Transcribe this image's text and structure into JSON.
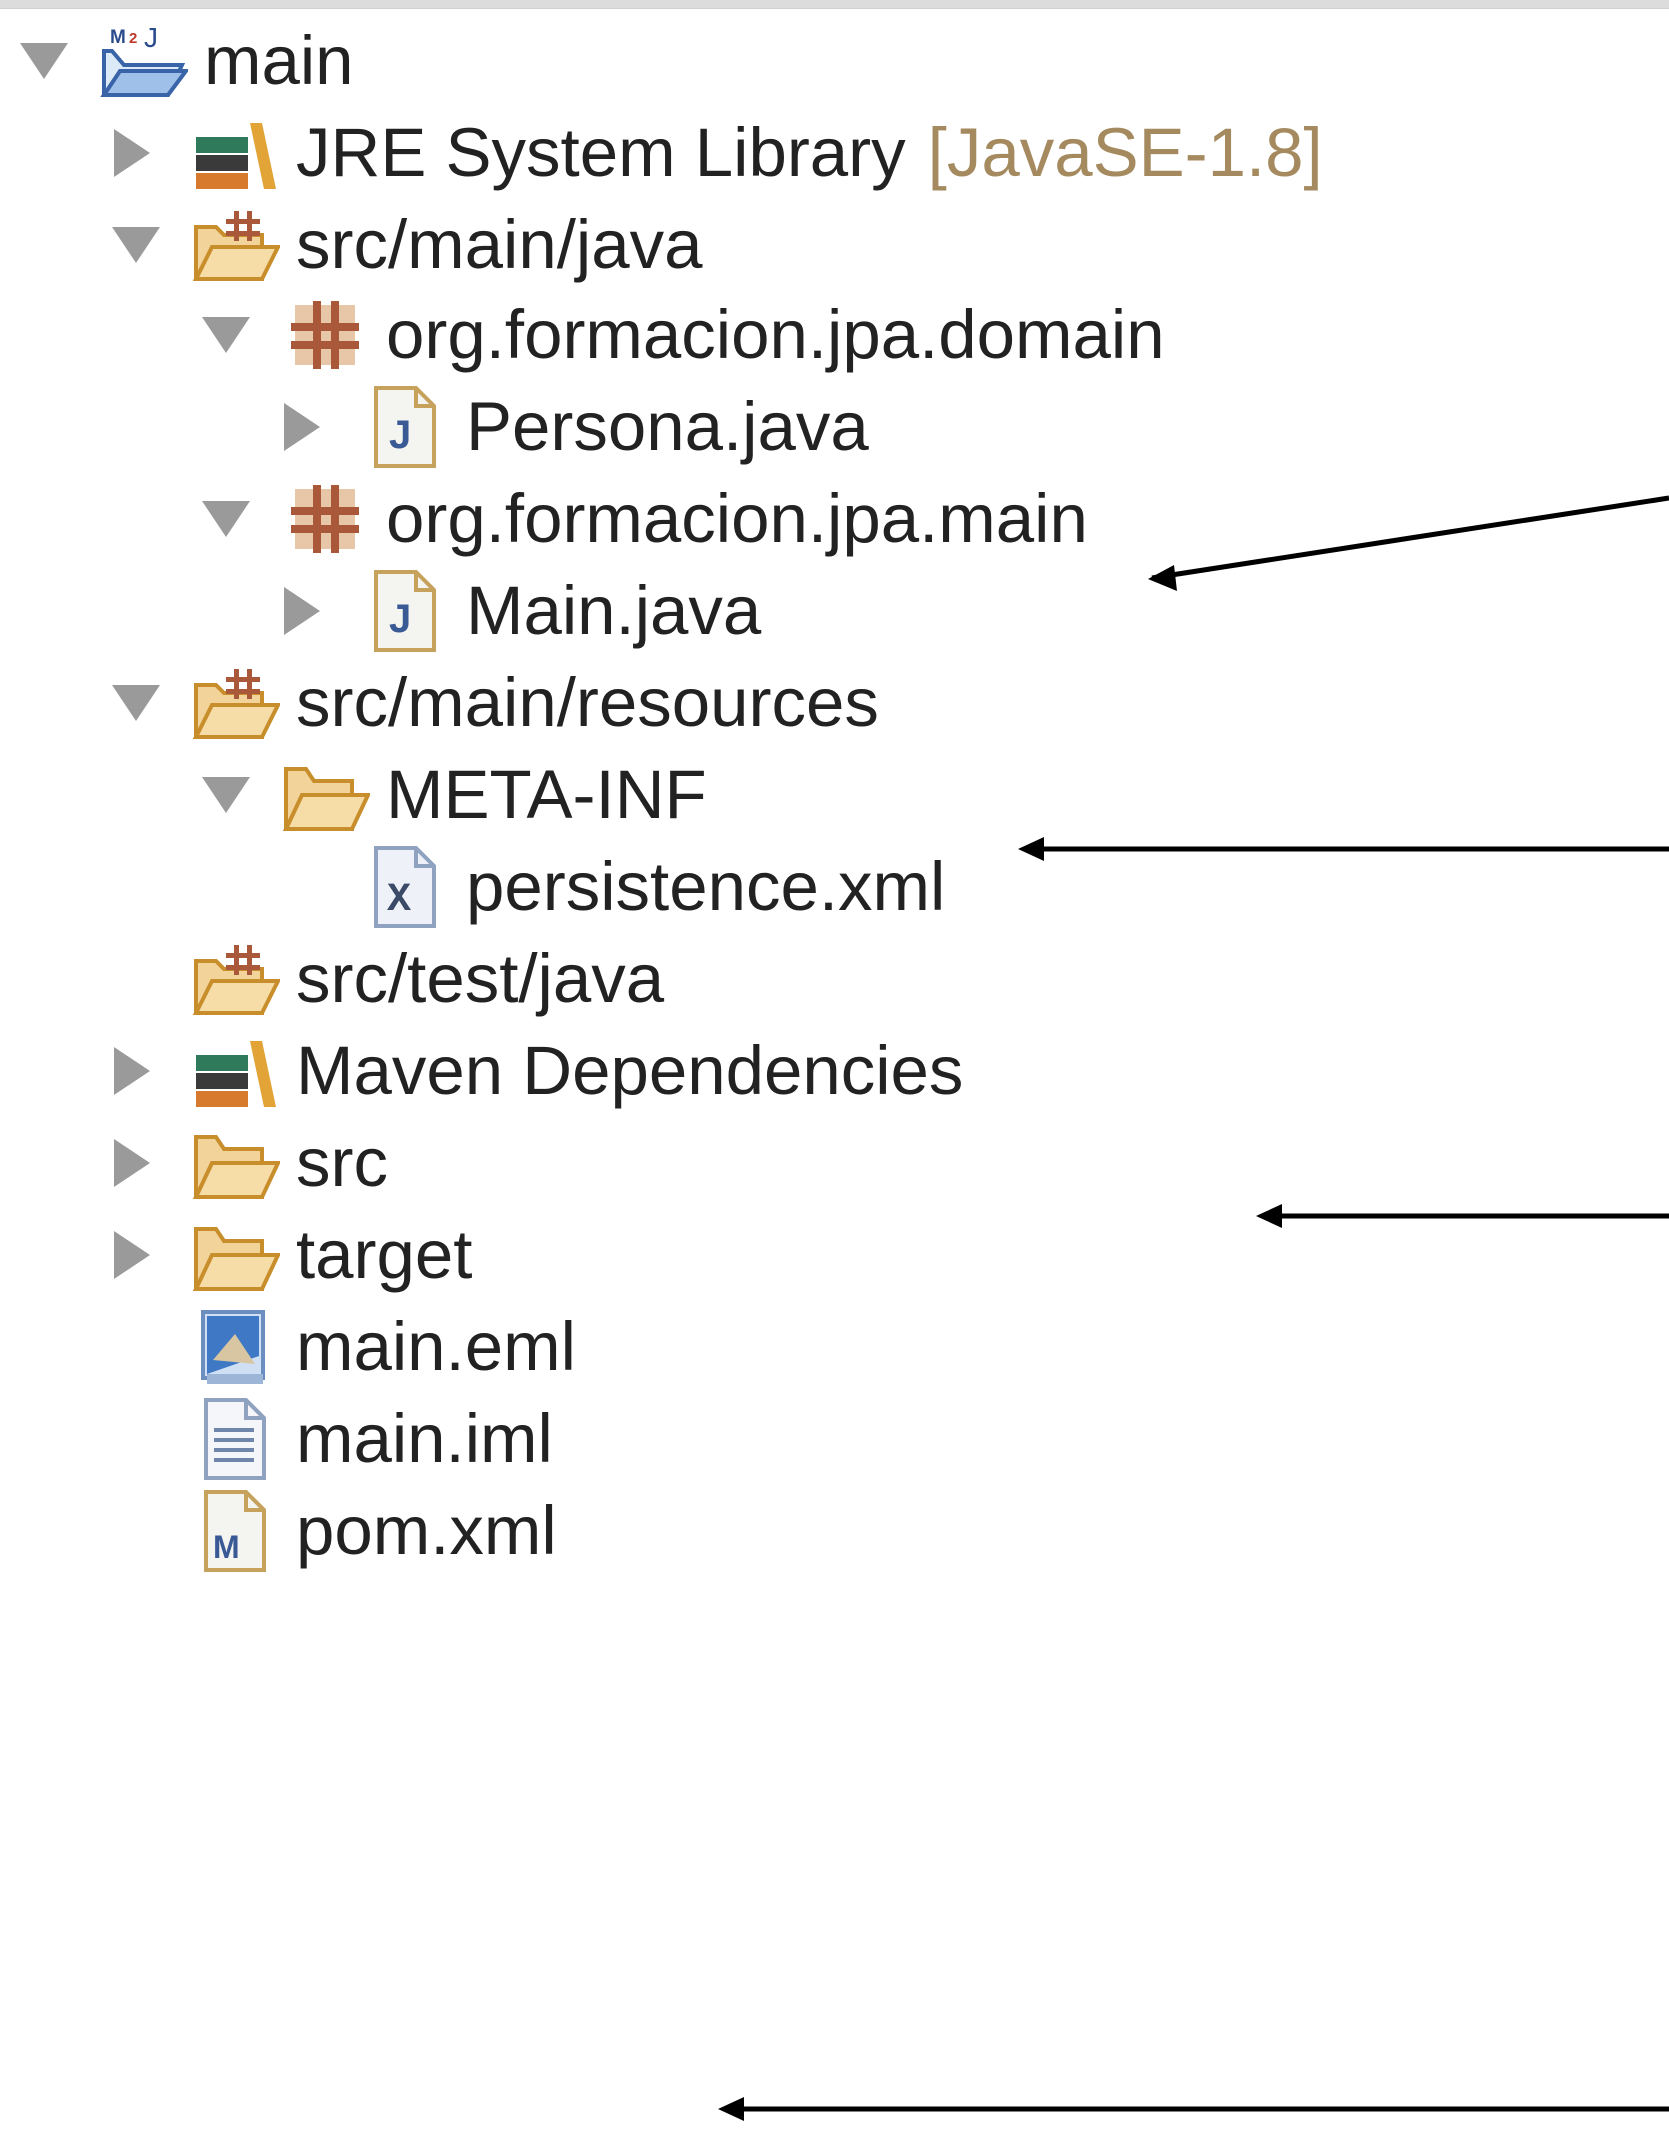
{
  "tree": {
    "project": {
      "label": "main",
      "icon": "maven-java-project-icon",
      "expanded": true
    },
    "jre": {
      "label": "JRE System Library",
      "decoration": "[JavaSE-1.8]",
      "icon": "library-icon",
      "expanded": false
    },
    "src_main_java": {
      "label": "src/main/java",
      "icon": "source-folder-icon",
      "expanded": true
    },
    "pkg_domain": {
      "label": "org.formacion.jpa.domain",
      "icon": "package-icon",
      "expanded": true
    },
    "persona": {
      "label": "Persona.java",
      "icon": "java-file-icon",
      "expanded": false
    },
    "pkg_main": {
      "label": "org.formacion.jpa.main",
      "icon": "package-icon",
      "expanded": true
    },
    "main_java": {
      "label": "Main.java",
      "icon": "java-file-icon",
      "expanded": false
    },
    "src_main_resources": {
      "label": "src/main/resources",
      "icon": "source-folder-icon",
      "expanded": true
    },
    "meta_inf": {
      "label": "META-INF",
      "icon": "folder-icon",
      "expanded": true
    },
    "persistence": {
      "label": "persistence.xml",
      "icon": "xml-file-icon"
    },
    "src_test_java": {
      "label": "src/test/java",
      "icon": "source-folder-icon"
    },
    "maven_deps": {
      "label": "Maven Dependencies",
      "icon": "library-icon",
      "expanded": false
    },
    "src": {
      "label": "src",
      "icon": "folder-icon",
      "expanded": false
    },
    "target": {
      "label": "target",
      "icon": "folder-icon",
      "expanded": false
    },
    "main_eml": {
      "label": "main.eml",
      "icon": "eml-file-icon"
    },
    "main_iml": {
      "label": "main.iml",
      "icon": "text-file-icon"
    },
    "pom": {
      "label": "pom.xml",
      "icon": "maven-pom-icon"
    }
  },
  "colors": {
    "label_text": "#222222",
    "decoration_text": "#a48a5e",
    "twisty": "#9a9a9a",
    "folder": "#e7b96a",
    "package": "#a9593a",
    "java_file": "#3a5a96",
    "arrow": "#000000"
  }
}
